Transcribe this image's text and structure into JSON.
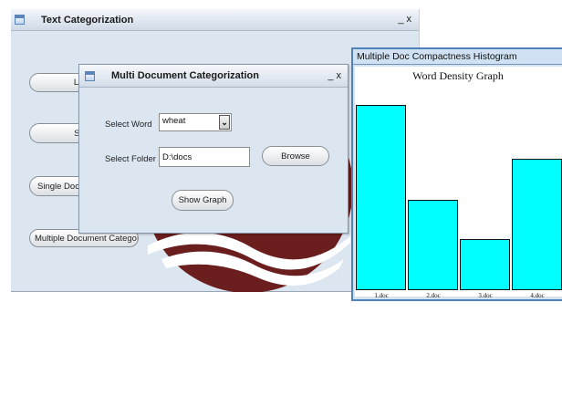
{
  "main_window": {
    "title": "Text Categorization",
    "controls": "_ x",
    "buttons": [
      "Learn",
      "Show",
      "Single Document Categorization",
      "Multiple Document Categorization"
    ]
  },
  "dialog": {
    "title": "Multi Document Categorization",
    "controls": "_ x",
    "select_word_label": "Select Word",
    "select_word_value": "wheat",
    "select_folder_label": "Select Folder",
    "select_folder_value": "D:\\docs",
    "browse_label": "Browse",
    "show_graph_label": "Show Graph"
  },
  "histogram_window": {
    "title": "Multiple Doc Compactness Histogram"
  },
  "chart_data": {
    "type": "bar",
    "title": "Word Density Graph",
    "categories": [
      "1.doc",
      "2.doc",
      "3.doc",
      "4.doc"
    ],
    "values": [
      90,
      44,
      25,
      64
    ],
    "ylim": [
      0,
      100
    ],
    "bar_color": "#00ffff",
    "grid": false
  },
  "colors": {
    "window_bg": "#dce6f1",
    "logo": "#6b1e1e",
    "titlebar": "#d6dfea"
  },
  "icons": [
    "window-icon"
  ]
}
